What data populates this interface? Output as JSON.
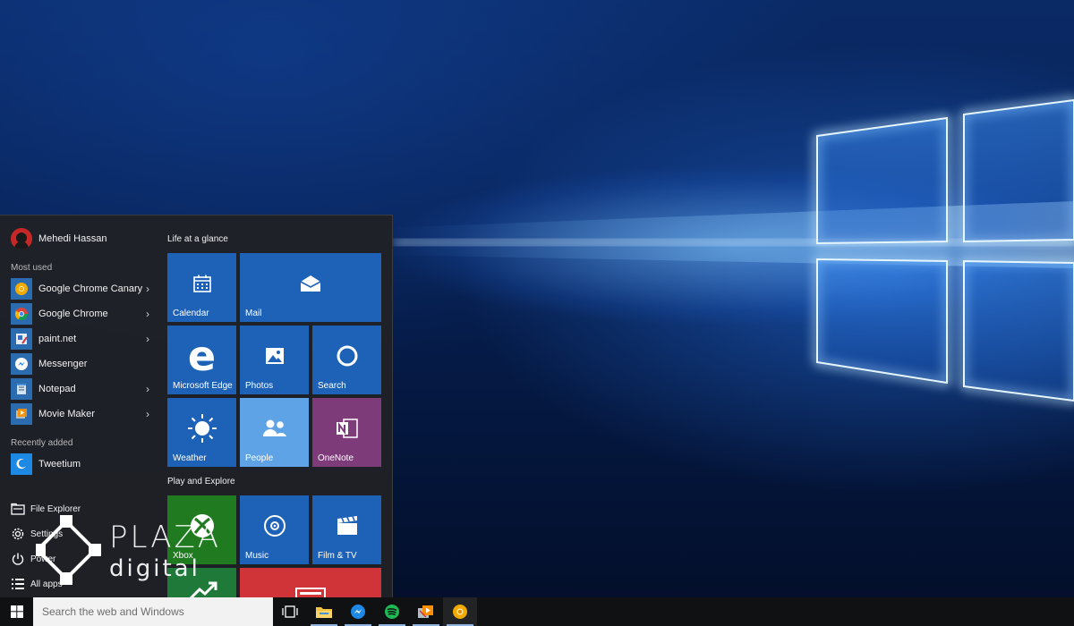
{
  "start_menu": {
    "user": {
      "name": "Mehedi Hassan",
      "icon": "user-avatar"
    },
    "most_used": {
      "label": "Most used",
      "items": [
        {
          "label": "Google Chrome Canary",
          "icon": "chrome-canary-icon",
          "has_submenu": true
        },
        {
          "label": "Google Chrome",
          "icon": "chrome-icon",
          "has_submenu": true
        },
        {
          "label": "paint.net",
          "icon": "paintnet-icon",
          "has_submenu": true
        },
        {
          "label": "Messenger",
          "icon": "messenger-icon",
          "has_submenu": false
        },
        {
          "label": "Notepad",
          "icon": "notepad-icon",
          "has_submenu": true
        },
        {
          "label": "Movie Maker",
          "icon": "movie-maker-icon",
          "has_submenu": true
        }
      ]
    },
    "recently_added": {
      "label": "Recently added",
      "items": [
        {
          "label": "Tweetium",
          "icon": "tweetium-icon"
        }
      ]
    },
    "system": {
      "file_explorer": "File Explorer",
      "settings": "Settings",
      "power": "Power",
      "all_apps": "All apps"
    },
    "tile_groups": [
      {
        "label": "Life at a glance"
      },
      {
        "label": "Play and Explore"
      }
    ],
    "tiles": {
      "calendar": "Calendar",
      "mail": "Mail",
      "edge": "Microsoft Edge",
      "photos": "Photos",
      "search": "Search",
      "weather": "Weather",
      "people": "People",
      "onenote": "OneNote",
      "xbox": "Xbox",
      "music": "Music",
      "film_tv": "Film & TV"
    },
    "tile_colors": {
      "default": "#1e62b8",
      "people": "#5ea3e6",
      "onenote": "#7e3b7a",
      "xbox": "#1f7a20",
      "money": "#1f7a3a",
      "news": "#d13438"
    }
  },
  "taskbar": {
    "search_placeholder": "Search the web and Windows",
    "apps": [
      "task-view-icon",
      "file-explorer-icon",
      "messenger-icon",
      "spotify-icon",
      "movie-maker-icon",
      "chrome-canary-icon"
    ]
  },
  "watermark": {
    "line1": "PLAZA",
    "line2": "digital"
  }
}
